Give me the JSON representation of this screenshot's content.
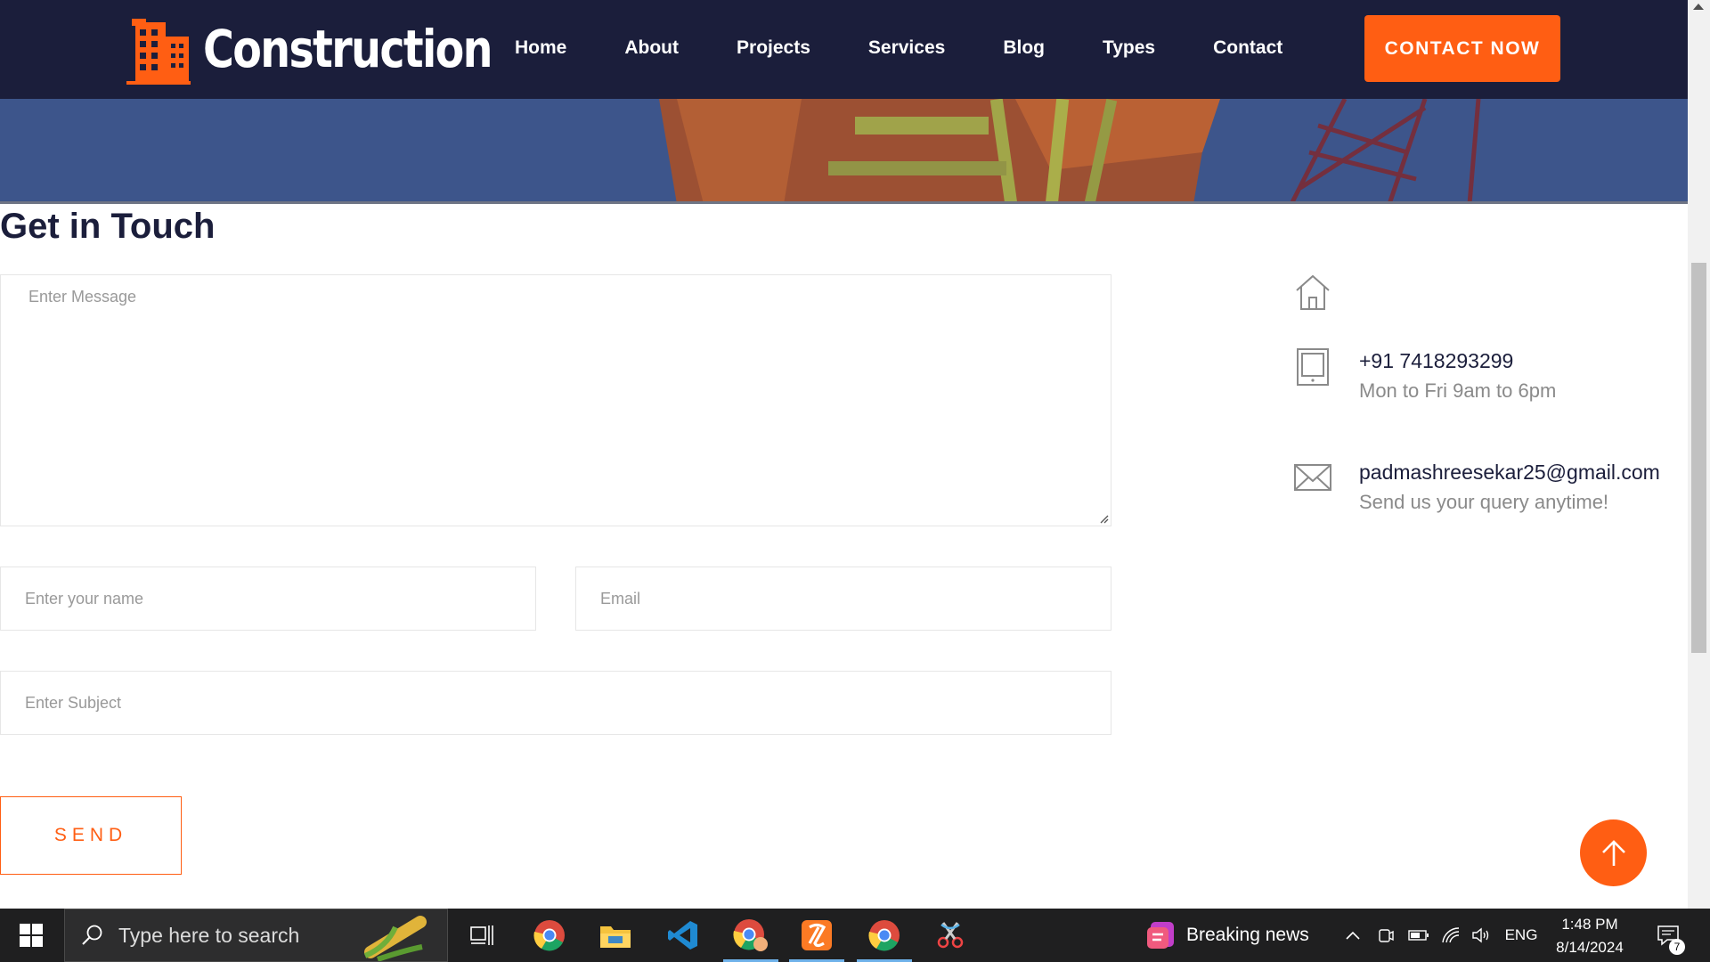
{
  "header": {
    "logo_text": "Construction",
    "nav": [
      "Home",
      "About",
      "Projects",
      "Services",
      "Blog",
      "Types",
      "Contact"
    ],
    "cta_label": "CONTACT NOW",
    "accent_color": "#ff5e13",
    "bg_color": "#1b1e3b"
  },
  "contact": {
    "title": "Get in Touch",
    "message_placeholder": "Enter Message",
    "name_placeholder": "Enter your name",
    "email_placeholder": "Email",
    "subject_placeholder": "Enter Subject",
    "send_label": "SEND",
    "phone": "+91 7418293299",
    "phone_hours": "Mon to Fri 9am to 6pm",
    "email": "padmashreesekar25@gmail.com",
    "email_note": "Send us your query anytime!"
  },
  "taskbar": {
    "search_placeholder": "Type here to search",
    "news_label": "Breaking news",
    "language": "ENG",
    "time": "1:48 PM",
    "date": "8/14/2024",
    "notification_count": "7"
  }
}
